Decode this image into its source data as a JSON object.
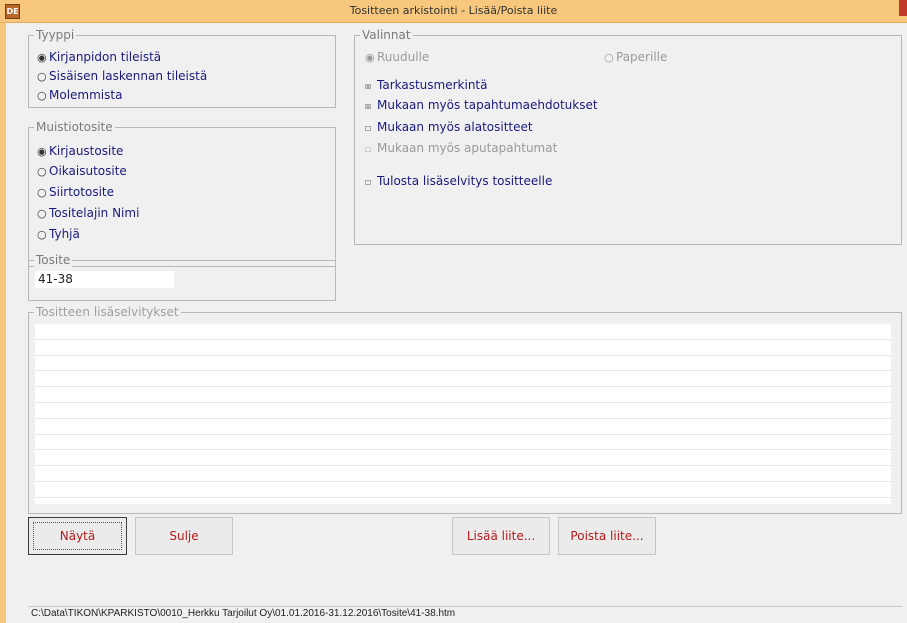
{
  "window": {
    "title": "Tositteen arkistointi - Lisää/Poista liite",
    "app_icon_text": "DE",
    "accent_color": "#f6c77c"
  },
  "tyyppi": {
    "legend": "Tyyppi",
    "options": [
      {
        "label": "Kirjanpidon tileistä",
        "selected": true
      },
      {
        "label": "Sisäisen laskennan tileistä",
        "selected": false
      },
      {
        "label": "Molemmista",
        "selected": false
      }
    ]
  },
  "muistiotosite": {
    "legend": "Muistiotosite",
    "options": [
      {
        "label": "Kirjaustosite",
        "selected": true
      },
      {
        "label": "Oikaisutosite",
        "selected": false
      },
      {
        "label": "Siirtotosite",
        "selected": false
      },
      {
        "label": "Tositelajin Nimi",
        "selected": false
      },
      {
        "label": "Tyhjä",
        "selected": false
      }
    ]
  },
  "tosite": {
    "legend": "Tosite",
    "value": "41-38"
  },
  "valinnat": {
    "legend": "Valinnat",
    "ruudulle": {
      "label": "Ruudulle",
      "selected": true,
      "enabled": false
    },
    "paperille": {
      "label": "Paperille",
      "selected": false,
      "enabled": false
    },
    "checks": [
      {
        "label": "Tarkastusmerkintä",
        "checked": true,
        "enabled": true
      },
      {
        "label": "Mukaan myös tapahtumaehdotukset",
        "checked": true,
        "enabled": true
      },
      {
        "label": "Mukaan myös alatositteet",
        "checked": false,
        "enabled": true
      },
      {
        "label": "Mukaan myös aputapahtumat",
        "checked": false,
        "enabled": false
      },
      {
        "label": "Tulosta lisäselvitys tositteelle",
        "checked": false,
        "enabled": true
      }
    ]
  },
  "lisaselvitykset": {
    "legend": "Tositteen lisäselvitykset",
    "value": ""
  },
  "buttons": {
    "nayta": "Näytä",
    "sulje": "Sulje",
    "lisaa_liite": "Lisää liite...",
    "poista_liite": "Poista liite..."
  },
  "status_path": "C:\\Data\\TIKON\\KPARKISTO\\0010_Herkku Tarjoilut Oy\\01.01.2016-31.12.2016\\Tosite\\41-38.htm"
}
